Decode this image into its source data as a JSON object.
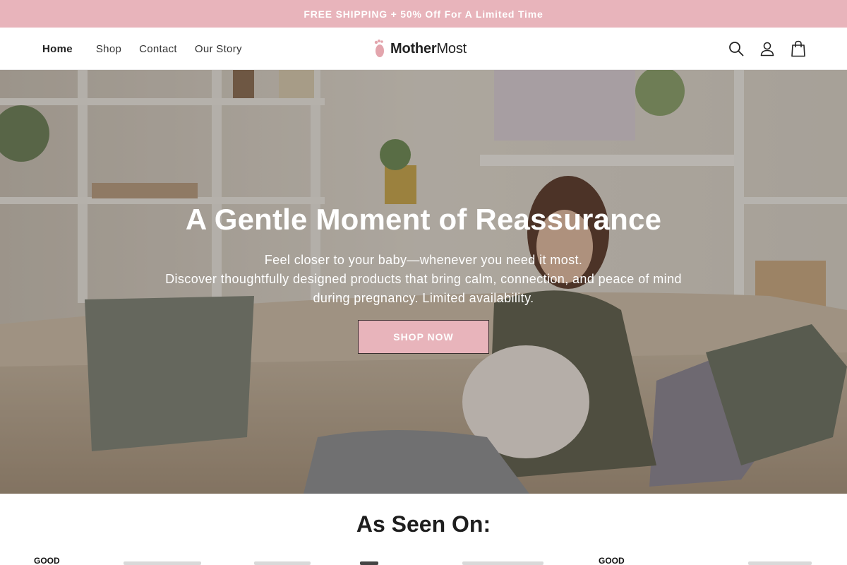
{
  "announcement": {
    "text": "FREE SHIPPING + 50% Off For A Limited Time"
  },
  "nav": {
    "items": [
      {
        "label": "Home",
        "active": true
      },
      {
        "label": "Shop",
        "active": false
      },
      {
        "label": "Contact",
        "active": false
      },
      {
        "label": "Our Story",
        "active": false
      }
    ]
  },
  "logo": {
    "part1": "Mother",
    "part2": "Most",
    "icon": "footprint-icon"
  },
  "header_icons": [
    "search-icon",
    "account-icon",
    "cart-icon"
  ],
  "hero": {
    "title": "A Gentle Moment of Reassurance",
    "subtitle_line1": "Feel closer to your baby—whenever you need it most.",
    "subtitle_line2": "Discover thoughtfully designed products that bring calm, connection, and peace of mind during pregnancy. Limited availability.",
    "button_label": "SHOP NOW"
  },
  "as_seen_on": {
    "heading": "As Seen On:",
    "logos": [
      "GOOD",
      "GOOD"
    ]
  },
  "colors": {
    "accent_pink": "#e8b4bb",
    "text_dark": "#222222"
  }
}
